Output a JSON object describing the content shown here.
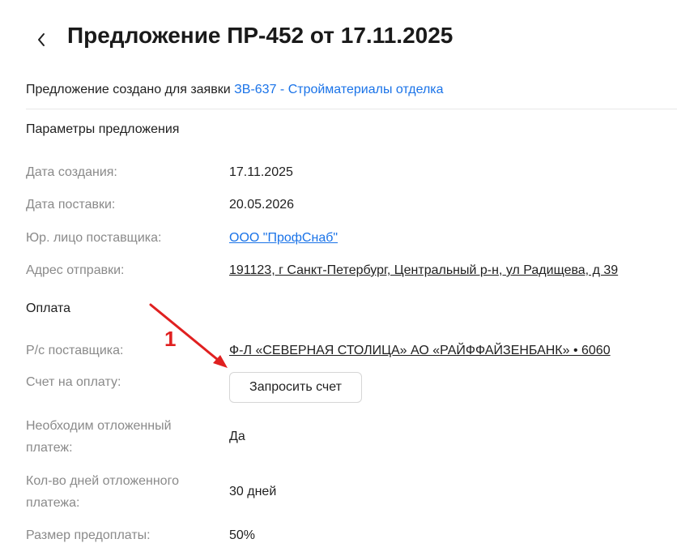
{
  "header": {
    "title": "Предложение ПР-452 от 17.11.2025"
  },
  "subtitle": {
    "prefix": "Предложение создано для заявки",
    "request_link": "ЗВ-637 - Стройматериалы отделка"
  },
  "params": {
    "section_title": "Параметры предложения",
    "rows": [
      {
        "label": "Дата создания:",
        "value": "17.11.2025"
      },
      {
        "label": "Дата поставки:",
        "value": "20.05.2026"
      },
      {
        "label": "Юр. лицо поставщика:",
        "value": "ООО \"ПрофСнаб\""
      },
      {
        "label": "Адрес отправки:",
        "value": "191123, г Санкт-Петербург, Центральный р-н, ул Радищева, д 39"
      }
    ]
  },
  "payment": {
    "section_title": "Оплата",
    "account_label": "Р/с поставщика:",
    "account_value": "Ф-Л «СЕВЕРНАЯ СТОЛИЦА» АО «РАЙФФАЙЗЕНБАНК» • 6060",
    "invoice_label": "Счет на оплату:",
    "invoice_button": "Запросить счет",
    "deferred_label_1": "Необходим отложенный",
    "deferred_label_2": "платеж:",
    "deferred_value": "Да",
    "days_label_1": "Кол-во дней отложенного",
    "days_label_2": "платежа:",
    "days_value": "30 дней",
    "prepay_label": "Размер предоплаты:",
    "prepay_value": "50%"
  },
  "annotation": {
    "number": "1",
    "color": "#e02020"
  },
  "colors": {
    "link": "#1a73e8",
    "label": "#8a8a8a",
    "text": "#1f1f1f"
  },
  "icons": {
    "back": "chevron-left-icon",
    "annotation": "arrow-icon"
  }
}
